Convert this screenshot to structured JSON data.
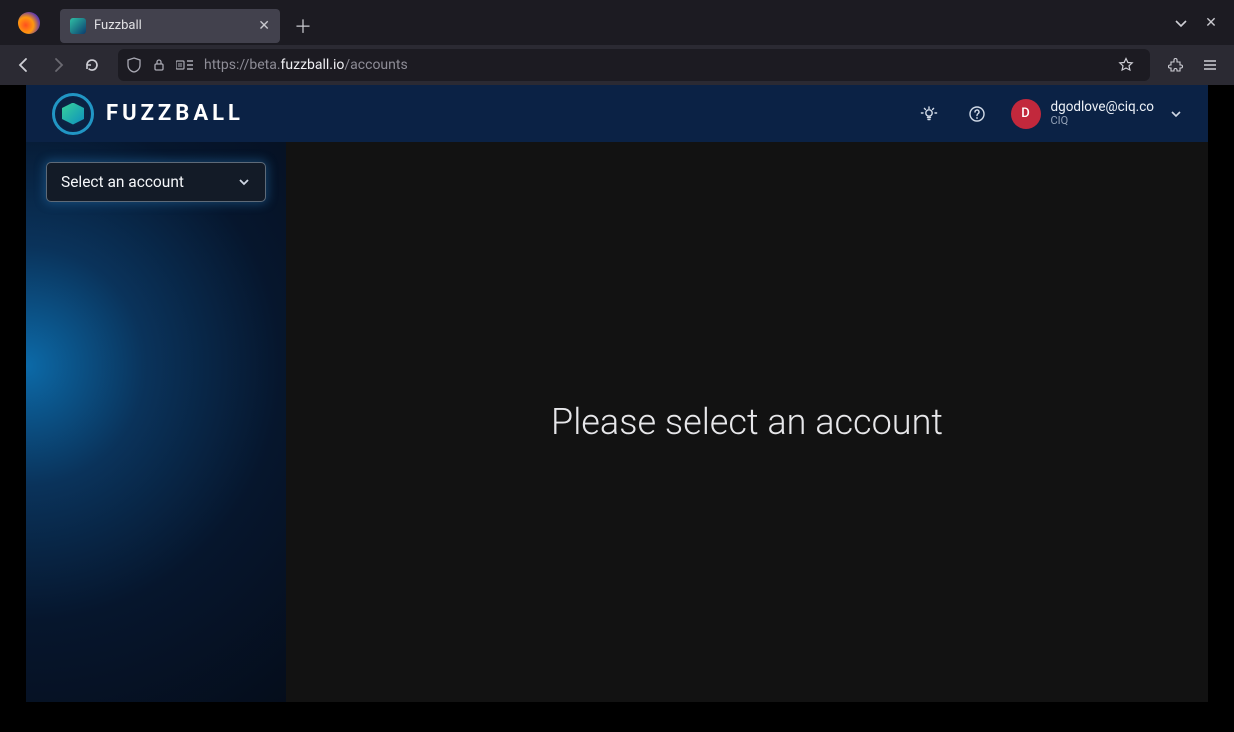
{
  "browser": {
    "tab_title": "Fuzzball",
    "url_prefix": "https://beta.",
    "url_strong": "fuzzball.io",
    "url_path": "/accounts"
  },
  "app": {
    "logo_text": "FUZZBALL",
    "header": {
      "user_email": "dgodlove@ciq.co",
      "user_org": "CIQ",
      "avatar_initial": "D"
    },
    "sidebar": {
      "account_select_label": "Select an account"
    },
    "content": {
      "prompt": "Please select an account"
    }
  }
}
